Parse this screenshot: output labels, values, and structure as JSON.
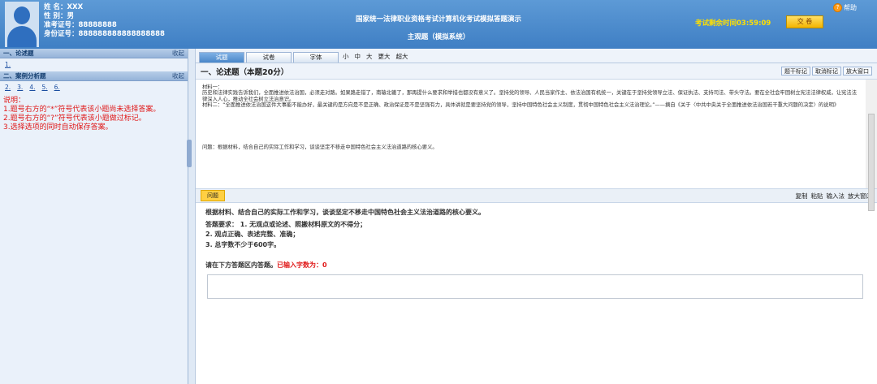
{
  "header": {
    "info": {
      "name_label": "姓 名：",
      "name": "XXX",
      "gender_label": "性 别：",
      "gender": "男",
      "ticket_label": "准考证号：",
      "ticket": "88888888",
      "id_label": "身份证号：",
      "id": "888888888888888888"
    },
    "title_line1": "国家统一法律职业资格考试计算机化考试模拟答题演示",
    "title_line2": "主观题（模拟系统）",
    "timer_label": "考试剩余时间",
    "timer_value": "03:59:09",
    "submit_label": "交 卷",
    "help_label": "帮助",
    "help_icon_char": "?"
  },
  "sidebar": {
    "section1_title": "一、论述题",
    "section1_collapse": "收起",
    "section1_questions": [
      "1."
    ],
    "section2_title": "二、案例分析题",
    "section2_collapse": "收起",
    "section2_questions": [
      "2.",
      "3.",
      "4.",
      "5.",
      "6."
    ],
    "notes": [
      "说明：",
      "1.题号右方的“*”符号代表该小题尚未选择答案。",
      "2.题号右方的“?”符号代表该小题做过标记。",
      "3.选择选项的同时自动保存答案。"
    ]
  },
  "main": {
    "tabs": [
      "试题",
      "试卷",
      "字体"
    ],
    "font_sizes": [
      "小",
      "中",
      "大",
      "更大",
      "超大"
    ],
    "question_title": "一、论述题（本题20分）",
    "tools": [
      "题干标记",
      "取消标记",
      "放大窗口"
    ],
    "material": {
      "label": "材料一：",
      "p1": "历史和法律实践告诉我们，全面推进依法治国，必须走对路。如果路走错了，南辕北辙了，那再提什么要求和举措也都没有意义了。坚持党的领导、人民当家作主、依法治国有机统一，关键在于坚持党领导立法、保证执法、支持司法、带头守法。要在全社会牢固树立宪法法律权威，让宪法法律深入人心，推动全社会树立法治意识。",
      "p2": "材料二：“全面推进依法治国这件大事能不能办好，最关键的是方向是不是正确、政治保证是不是坚强有力，具体讲就是要坚持党的领导，坚持中国特色社会主义制度，贯彻中国特色社会主义法治理论。”——摘自《关于〈中共中央关于全面推进依法治国若干重大问题的决定〉的说明》",
      "question": "问题：根据材料，结合自己的实际工作和学习，谈谈坚定不移走中国特色社会主义法治道路的核心要义。"
    },
    "answer_tab": "问题",
    "answer_tools": [
      "复制",
      "粘贴",
      "输入法",
      "放大窗口"
    ],
    "question_text": "根据材料、结合自己的实际工作和学习，谈谈坚定不移走中国特色社会主义法治道路的核心要义。",
    "requirements": [
      "答题要求：  1. 无观点或论述、照搬材料原文的不得分；",
      "2. 观点正确、表述完整、准确；",
      "3. 总字数不少于600字。"
    ],
    "prompt_text": "请在下方答题区内答题。",
    "count_label": "已输入字数为：",
    "count_value": "0"
  }
}
